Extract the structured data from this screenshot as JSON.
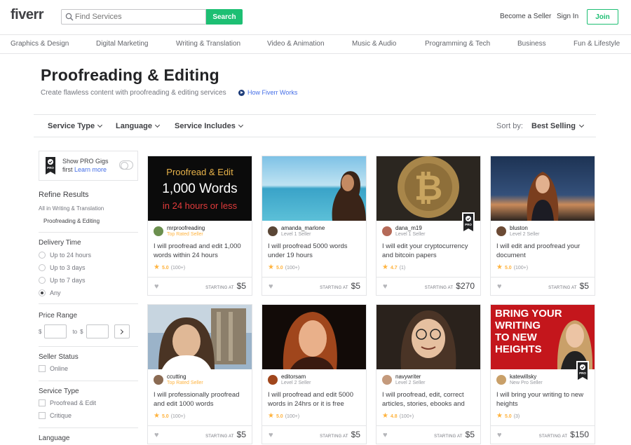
{
  "header": {
    "logo": "fiverr",
    "search_placeholder": "Find Services",
    "search_button": "Search",
    "become_seller": "Become a Seller",
    "sign_in": "Sign In",
    "join": "Join"
  },
  "categories": [
    "Graphics & Design",
    "Digital Marketing",
    "Writing & Translation",
    "Video & Animation",
    "Music & Audio",
    "Programming & Tech",
    "Business",
    "Fun & Lifestyle"
  ],
  "page": {
    "title": "Proofreading & Editing",
    "subtitle": "Create flawless content with proofreading & editing services",
    "how_link": "How Fiverr Works"
  },
  "filters": {
    "service_type": "Service Type",
    "language": "Language",
    "service_includes": "Service Includes",
    "sort_label": "Sort by:",
    "sort_value": "Best Selling"
  },
  "sidebar": {
    "pro_line1": "Show PRO Gigs",
    "pro_line2": "first",
    "pro_learn": "Learn more",
    "refine": "Refine Results",
    "crumb_parent": "All in Writing & Translation",
    "crumb_current": "Proofreading & Editing",
    "delivery_title": "Delivery Time",
    "delivery_options": [
      "Up to 24 hours",
      "Up to 3 days",
      "Up to 7 days",
      "Any"
    ],
    "delivery_selected": "Any",
    "price_title": "Price Range",
    "price_currency": "$",
    "price_to": "to",
    "seller_status_title": "Seller Status",
    "seller_status_options": [
      "Online"
    ],
    "service_type_title": "Service Type",
    "service_type_options": [
      "Proofread & Edit",
      "Critique"
    ],
    "language_title": "Language"
  },
  "gigs": [
    {
      "seller": "mrproofreading",
      "level": "Top Rated Seller",
      "title": "I will proofread and edit 1,000 words within 24 hours",
      "rating": "5.0",
      "count": "(100+)",
      "starting": "STARTING AT",
      "price": "$5",
      "thumb_text": [
        "Proofread & Edit",
        "1,000 Words",
        "in 24 hours or less"
      ],
      "pro": false
    },
    {
      "seller": "amanda_marlone",
      "level": "Level 1 Seller",
      "title": "I will proofread 5000 words under 19 hours",
      "rating": "5.0",
      "count": "(100+)",
      "starting": "STARTING AT",
      "price": "$5",
      "pro": false
    },
    {
      "seller": "dana_m19",
      "level": "Level 1 Seller",
      "title": "I will edit your cryptocurrency and bitcoin papers",
      "rating": "4.7",
      "count": "(1)",
      "starting": "STARTING AT",
      "price": "$270",
      "pro": true
    },
    {
      "seller": "bluston",
      "level": "Level 2 Seller",
      "title": "I will edit and proofread your document",
      "rating": "5.0",
      "count": "(100+)",
      "starting": "STARTING AT",
      "price": "$5",
      "pro": false
    },
    {
      "seller": "ccutting",
      "level": "Top Rated Seller",
      "title": "I will professionally proofread and edit 1000 words",
      "rating": "5.0",
      "count": "(100+)",
      "starting": "STARTING AT",
      "price": "$5",
      "pro": false
    },
    {
      "seller": "editorsam",
      "level": "Level 2 Seller",
      "title": "I will proofread and edit 5000 words in 24hrs or it is free",
      "rating": "5.0",
      "count": "(100+)",
      "starting": "STARTING AT",
      "price": "$5",
      "pro": false
    },
    {
      "seller": "navywriter",
      "level": "Level 2 Seller",
      "title": "I will proofread, edit, correct articles, stories, ebooks and",
      "rating": "4.8",
      "count": "(100+)",
      "starting": "STARTING AT",
      "price": "$5",
      "pro": false
    },
    {
      "seller": "katewillsky",
      "level": "New Pro Seller",
      "title": "I will bring your writing to new heights",
      "rating": "5.0",
      "count": "(3)",
      "starting": "STARTING AT",
      "price": "$150",
      "thumb_text": [
        "BRING YOUR",
        "WRITING",
        "TO NEW",
        "HEIGHTS"
      ],
      "pro": true
    }
  ],
  "colors": {
    "brand_green": "#1dbf73",
    "star": "#ffb33e",
    "link": "#446ee7",
    "top_rated": "#ffb33e"
  }
}
